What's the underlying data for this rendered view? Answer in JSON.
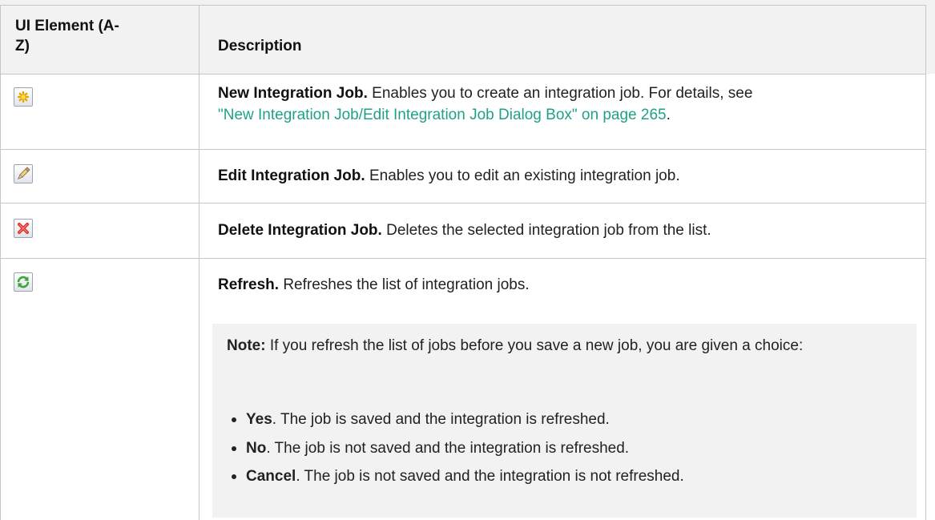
{
  "header": {
    "col1_line1": "UI Element (A-",
    "col1_line2": "Z)",
    "col2": "Description"
  },
  "rows": [
    {
      "icon": "new-job-star-icon",
      "title": "New Integration Job.",
      "text": "Enables you to create an integration job. For details, see",
      "link": "\"New Integration Job/Edit Integration Job Dialog Box\" on page 265",
      "after_link": "."
    },
    {
      "icon": "edit-pencil-icon",
      "title": "Edit Integration Job.",
      "text": "Enables you to edit an existing integration job."
    },
    {
      "icon": "delete-x-icon",
      "title": "Delete Integration Job.",
      "text": "Deletes the selected integration job from the list."
    },
    {
      "icon": "refresh-icon",
      "title": "Refresh.",
      "text": "Refreshes the list of integration jobs.",
      "note": {
        "label": "Note:",
        "text": "If you refresh the list of jobs before you save a new job, you are given a choice:",
        "options": [
          {
            "label": "Yes",
            "text": ". The job is saved and the integration is refreshed."
          },
          {
            "label": "No",
            "text": ". The job is not saved and the integration is refreshed."
          },
          {
            "label": "Cancel",
            "text": ". The job is not saved and the integration is not refreshed."
          }
        ]
      }
    }
  ],
  "colors": {
    "link": "#1fa188",
    "header_bg": "#f2f2f2",
    "border": "#c6c6c6",
    "note_bg": "#f2f2f2"
  }
}
